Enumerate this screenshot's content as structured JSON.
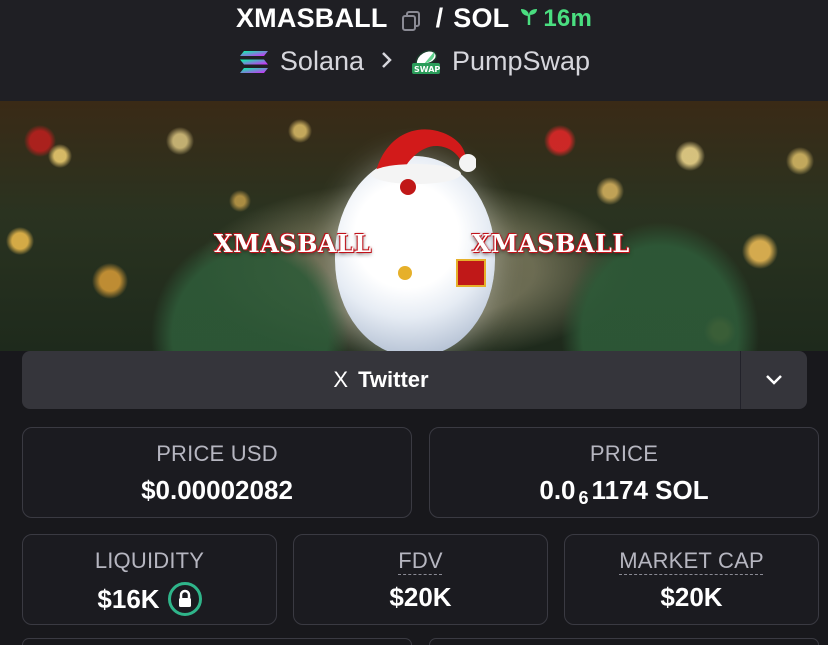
{
  "header": {
    "token_symbol": "XMASBALL",
    "pair_separator": "/",
    "quote_symbol": "SOL",
    "age": "16m",
    "chain": "Solana",
    "dex": "PumpSwap",
    "dex_logo_text": "SWAP"
  },
  "banner": {
    "text_left": "XMASBALL",
    "text_right": "XMASBALL"
  },
  "links": {
    "twitter_icon": "X",
    "twitter_label": "Twitter"
  },
  "stats": {
    "price_usd_label": "PRICE USD",
    "price_usd_value": "$0.00002082",
    "price_label": "PRICE",
    "price_value_prefix": "0.0",
    "price_value_subscript": "6",
    "price_value_rest": "1174 SOL",
    "liquidity_label": "LIQUIDITY",
    "liquidity_value": "$16K",
    "fdv_label": "FDV",
    "fdv_value": "$20K",
    "market_cap_label": "MARKET CAP",
    "market_cap_value": "$20K"
  },
  "colors": {
    "age_green": "#4ade80",
    "lock_green": "#2fb58a",
    "background": "#18181c"
  },
  "icons": [
    "copy-icon",
    "seedling-icon",
    "solana-logo-icon",
    "chevron-right-icon",
    "pumpswap-logo-icon",
    "x-logo-icon",
    "chevron-down-icon",
    "lock-icon"
  ]
}
